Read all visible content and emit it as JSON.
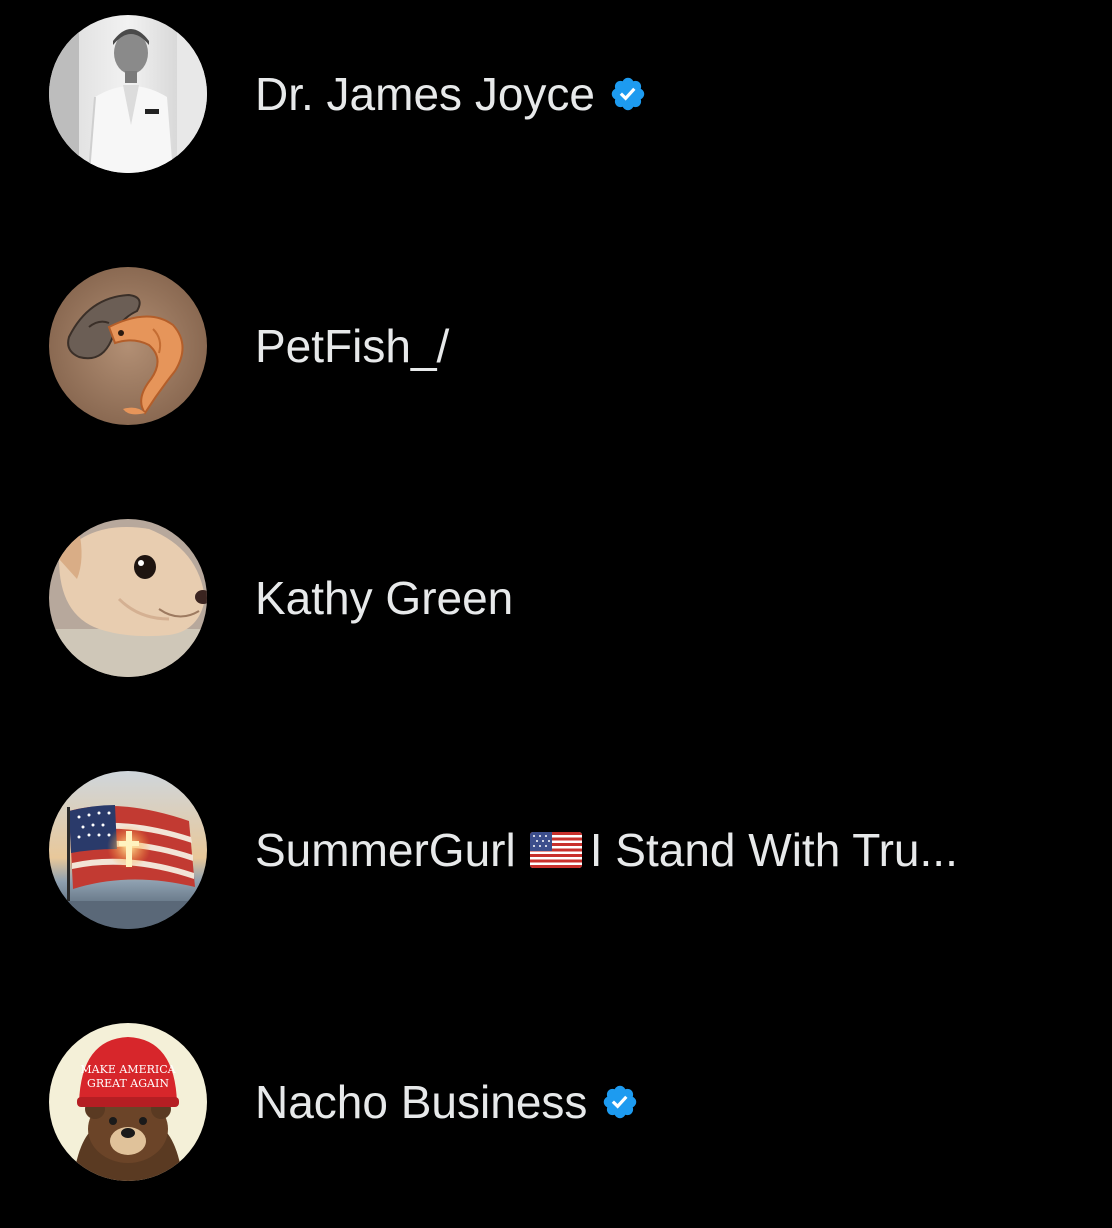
{
  "colors": {
    "background": "#000000",
    "text": "#e7e9ea",
    "verified_badge": "#1d9bf0"
  },
  "users": [
    {
      "name": "Dr. James Joyce",
      "verified": true,
      "avatar_icon": "portrait-man-white-suit-avatar"
    },
    {
      "name": "PetFish_/",
      "verified": false,
      "avatar_icon": "koi-fish-painting-avatar"
    },
    {
      "name": "Kathy Green",
      "verified": false,
      "avatar_icon": "chihuahua-dog-avatar"
    },
    {
      "name": "SummerGurl",
      "name_suffix": "I Stand With Tru...",
      "flag_icon": "us-flag-emoji",
      "verified": false,
      "avatar_icon": "american-flag-sunset-avatar"
    },
    {
      "name": "Nacho Business",
      "verified": true,
      "avatar_icon": "bear-red-cap-avatar",
      "avatar_cap_text": "MAKE AMERICA GREAT AGAIN"
    }
  ]
}
